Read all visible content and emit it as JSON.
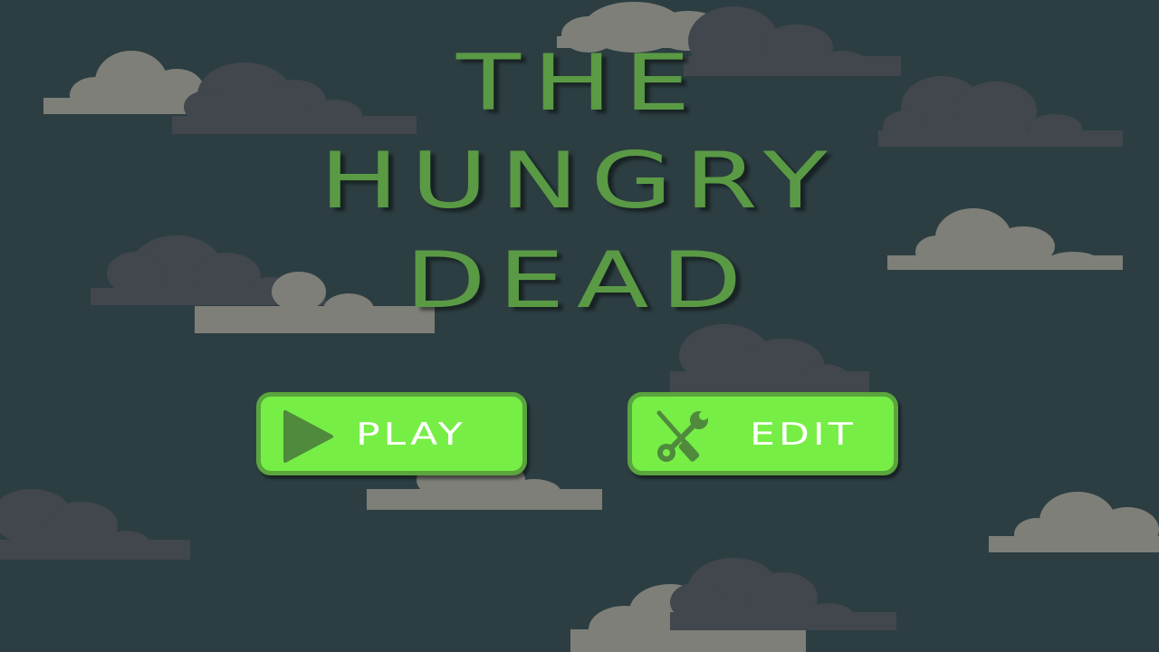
{
  "title_lines": [
    "THE",
    "HUNGRY",
    "DEAD"
  ],
  "buttons": {
    "play": {
      "label": "PLAY",
      "icon": "play-triangle-icon"
    },
    "edit": {
      "label": "EDIT",
      "icon": "tools-icon"
    }
  },
  "colors": {
    "background": "#2c3e42",
    "title": "#5a9a45",
    "button_fill": "#77ee46",
    "button_border": "#5aa53e",
    "icon": "#4f8a3d",
    "cloud_light": "#7e7f78",
    "cloud_dark": "#41474d"
  }
}
